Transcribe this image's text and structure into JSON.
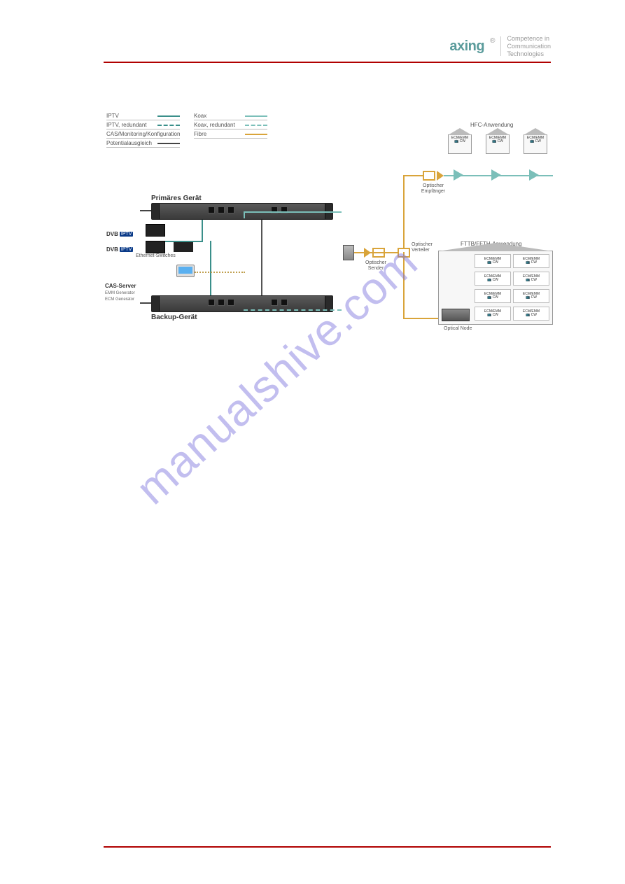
{
  "brand": {
    "name": "axing",
    "registered": "®",
    "tagline_l1": "Competence in",
    "tagline_l2": "Communication",
    "tagline_l3": "Technologies"
  },
  "legend": {
    "col1": {
      "iptv": "IPTV",
      "iptv_redundant": "IPTV, redundant",
      "cas": "CAS/Monitoring/Konfiguration",
      "pe": "Potentialausgleich"
    },
    "col2": {
      "koax": "Koax",
      "koax_redundant": "Koax, redundant",
      "fibre": "Fibre"
    }
  },
  "devices": {
    "primary_label": "Primäres Gerät",
    "backup_label": "Backup-Gerät",
    "dvb": "DVB",
    "iptv_badge": "IPTV",
    "ethernet_switches": "Ethernet-Switches",
    "cas_title": "CAS-Server",
    "cas_sub1": "EMM Generator",
    "cas_sub2": "ECM Generator"
  },
  "optical": {
    "sender": "Optischer\nSender",
    "verteiler": "Optischer\nVerteiler",
    "empfaenger": "Optischer\nEmpfänger"
  },
  "hfc": {
    "title": "HFC-Anwendung",
    "house_model": "ECM/EMM",
    "house_sub": "CW"
  },
  "fttb": {
    "title": "FTTB/FFTH-Anwendung",
    "apt_model": "ECM/EMM",
    "apt_sub": "CW",
    "optical_node": "Optical Node"
  },
  "watermark": "manualshive.com"
}
